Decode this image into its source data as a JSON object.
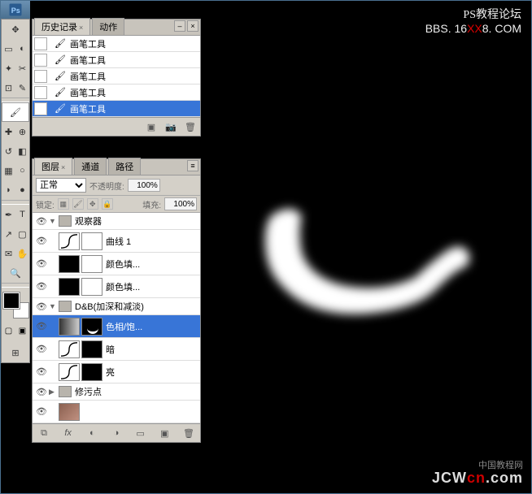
{
  "watermark": {
    "line1": "PS教程论坛",
    "line2_pre": "BBS. 16",
    "line2_mid": "XX",
    "line2_post": "8. COM",
    "bottom_cn": "中国教程网",
    "bottom_pre": "JCW",
    "bottom_mid": "cn",
    "bottom_post": ".com"
  },
  "history": {
    "tab_history": "历史记录",
    "tab_actions": "动作",
    "items": [
      {
        "label": "画笔工具"
      },
      {
        "label": "画笔工具"
      },
      {
        "label": "画笔工具"
      },
      {
        "label": "画笔工具"
      },
      {
        "label": "画笔工具"
      }
    ],
    "selected_index": 4
  },
  "layers": {
    "tab_layers": "图层",
    "tab_channels": "通道",
    "tab_paths": "路径",
    "blend_mode": "正常",
    "opacity_label": "不透明度:",
    "opacity_value": "100%",
    "lock_label": "锁定:",
    "fill_label": "填充:",
    "fill_value": "100%",
    "groups": [
      {
        "name": "观察器",
        "expanded": true,
        "layers": [
          {
            "name": "曲线 1",
            "thumb": "curve",
            "mask": "white"
          },
          {
            "name": "颜色填...",
            "thumb": "black",
            "mask": "white"
          },
          {
            "name": "颜色填...",
            "thumb": "black",
            "mask": "white"
          }
        ]
      },
      {
        "name": "D&B(加深和减淡)",
        "expanded": true,
        "layers": [
          {
            "name": "色相/饱...",
            "thumb": "gradient",
            "mask": "curve-shape",
            "selected": true
          },
          {
            "name": "暗",
            "thumb": "curve",
            "mask": "dark"
          },
          {
            "name": "亮",
            "thumb": "curve",
            "mask": "dark"
          }
        ]
      },
      {
        "name": "修污点",
        "expanded": false,
        "layers": []
      }
    ],
    "bottom_layer_visible": true
  }
}
